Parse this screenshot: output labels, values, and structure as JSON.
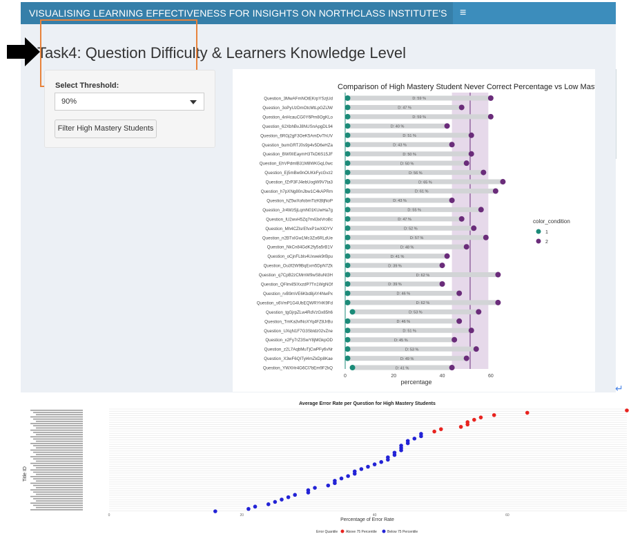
{
  "header": {
    "brand_title": "VISUALISING LEARNING EFFECTIVENESS FOR INSIGHTS ON NORTHCLASS INSTITUTE'S",
    "menu_icon": "hamburger-icon"
  },
  "page": {
    "title": "Task4: Question Difficulty & Learners Knowledge Level"
  },
  "sidebar_panel": {
    "threshold_label": "Select Threshold:",
    "threshold_value": "90%",
    "filter_button": "Filter High Mastery Students"
  },
  "colors": {
    "navbar": "#3c8dbc",
    "teal": "#1b8a78",
    "purple": "#6a2c7a",
    "red": "#e8231f",
    "blue": "#2323d6",
    "highlight": "#e8823a"
  },
  "chart_data": [
    {
      "type": "scatter",
      "title": "Comparison of High Mastery Student Never Correct Percentage vs Low Mastery",
      "xlabel": "percentage",
      "ylabel": "",
      "xlim": [
        0,
        70
      ],
      "xticks": [
        "0",
        "20",
        "40",
        "60"
      ],
      "legend": {
        "title": "color_condition",
        "entries": [
          "1",
          "2"
        ],
        "position": "right"
      },
      "categories": [
        "Question_3MwAFmNOtEKrpYSzjUd",
        "Question_3oPyUzDmOtcMtLpGZiJW",
        "Question_4nHcauCG0Y6Pm8OgKLo",
        "Question_62XbhBvJ8NUSnApgDL94",
        "Question_6RGj2gF3OeK5AmDvThUV",
        "Question_bumGRTJ0s9p4v5D6eHZa",
        "Question_BW0IIEaymH3TkD6S15JF",
        "Question_EhVPdmlB31M8WKGqL0wc",
        "Question_Ej5mBw9nOUKkFycGvz2",
        "Question_fZrP3FJ4ebUogW9V7ta3",
        "Question_h7pXNg80nJbw1C4kAPRm",
        "Question_hZ5wXofobmTizKBljNoP",
        "Question_Jr4Wz5jLqmN01KUwHa7g",
        "Question_lU2wvH5Zq7m43xiVroBc",
        "Question_Mh4CZlsrEfvxP1wXlOYV",
        "Question_n2BTxIGw1Mc3Zo6RLdUe",
        "Question_NkCn84GdK2fy5a5rB1V",
        "Question_oCjnFLbls4Uxwek9rBpu",
        "Question_Ou3f2W9BqExm5DpN7Zk",
        "Question_q7CpB2zCMmW9wS8uNt3H",
        "Question_QFlm45IXxzdP7Tn1WgNOf",
        "Question_rvB9mVE6Kbd8jAY4NwPx",
        "Question_s6VmP1G4UbEQWRYHK9Fd",
        "Question_tgGjrpZLw4RdVzGx85h6",
        "Question_TmKa3vlNoXYq4FZ8JrBu",
        "Question_UXqN1F7G3Sbldz02vZne",
        "Question_x2Fy7rZ3SwY8jMGkpOD",
        "Question_z2L7AqbMuTjCwPFy6vNr",
        "Question_X3wF6QITyl4mZkDp8Kae",
        "Question_YWXHr4G6Cl7bEm9F2kQ"
      ],
      "series": [
        {
          "name": "1",
          "values": [
            1,
            1,
            1,
            1,
            1,
            1,
            1,
            1,
            1,
            1,
            1,
            1,
            1,
            1,
            1,
            1,
            1,
            1,
            1,
            1,
            1,
            1,
            1,
            3,
            1,
            1,
            1,
            1,
            1,
            3
          ]
        },
        {
          "name": "2",
          "values": [
            60,
            48,
            60,
            42,
            52,
            44,
            52,
            50,
            57,
            65,
            62,
            44,
            56,
            48,
            53,
            58,
            50,
            42,
            40,
            63,
            40,
            47,
            63,
            55,
            47,
            52,
            45,
            54,
            50,
            44
          ]
        }
      ],
      "diff_labels": [
        "D: 59 %",
        "D: 47 %",
        "D: 59 %",
        "D: 40 %",
        "D: 51 %",
        "D: 43 %",
        "D: 50 %",
        "D: 50 %",
        "D: 56 %",
        "D: 65 %",
        "D: 61 %",
        "D: 43 %",
        "D: 55 %",
        "D: 47 %",
        "D: 52 %",
        "D: 57 %",
        "D: 48 %",
        "D: 41 %",
        "D: 39 %",
        "D: 62 %",
        "D: 39 %",
        "D: 46 %",
        "D: 62 %",
        "D: 53 %",
        "D: 46 %",
        "D: 51 %",
        "D: 45 %",
        "D: 53 %",
        "D: 49 %",
        "D: 41 %"
      ],
      "band": [
        44,
        59
      ],
      "reference_line": 51.5
    },
    {
      "type": "scatter",
      "title": "Average Error Rate per Question for High Mastery Students",
      "xlabel": "Percentage of Error Rate",
      "ylabel": "Title ID",
      "xlim": [
        0,
        78
      ],
      "xticks": [
        "0",
        "20",
        "40",
        "60"
      ],
      "legend": {
        "title": "Error Quantile",
        "entries": [
          "Above 75 Percentile",
          "Below 75 Percentile"
        ],
        "position": "bottom"
      },
      "series": [
        {
          "name": "Above 75 Percentile",
          "values": [
            78,
            63,
            58,
            56,
            55,
            54,
            54,
            53,
            50,
            49
          ]
        },
        {
          "name": "Below 75 Percentile",
          "values": [
            47,
            47,
            46,
            45,
            45,
            44,
            44,
            44,
            43,
            43,
            42,
            42,
            41,
            40,
            39,
            38,
            37,
            37,
            36,
            35,
            34,
            34,
            33,
            31,
            30,
            30,
            28,
            27,
            26,
            25,
            24,
            22,
            21,
            16
          ]
        }
      ]
    }
  ]
}
